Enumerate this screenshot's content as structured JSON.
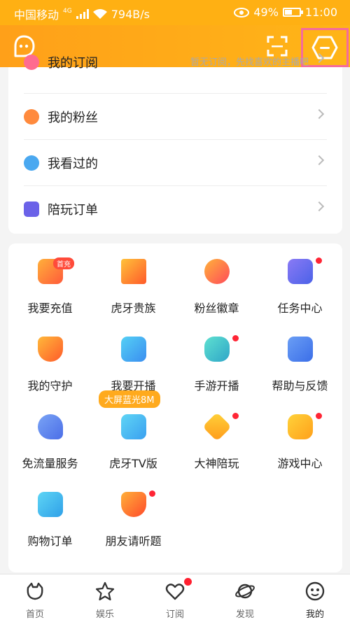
{
  "status_bar": {
    "carrier": "中国移动",
    "network": "4G",
    "speed": "794B/s",
    "battery": "49%",
    "time": "11:00"
  },
  "header": {
    "icons": [
      "message-icon",
      "scan-icon",
      "hexagon-icon"
    ]
  },
  "menu_list": [
    {
      "label": "我的订阅",
      "hint": "暂无订阅，先找喜欢的主播吧",
      "icon": "subscribe-icon",
      "color": "#ff6b8f"
    },
    {
      "label": "我的粉丝",
      "hint": "",
      "icon": "fans-icon",
      "color": "#ff8a3d"
    },
    {
      "label": "我看过的",
      "hint": "",
      "icon": "history-icon",
      "color": "#4aa8f0"
    },
    {
      "label": "陪玩订单",
      "hint": "",
      "icon": "order-icon",
      "color": "#6b62e8"
    }
  ],
  "grid": [
    {
      "label": "我要充值",
      "icon": "wallet-icon",
      "tag": "首充",
      "dot": false,
      "color": "#ff7a3a"
    },
    {
      "label": "虎牙贵族",
      "icon": "crown-icon",
      "tag": "",
      "dot": false,
      "color": "#ff8a2a"
    },
    {
      "label": "粉丝徽章",
      "icon": "heart-badge-icon",
      "tag": "",
      "dot": false,
      "color": "#ff6b4a"
    },
    {
      "label": "任务中心",
      "icon": "task-icon",
      "tag": "",
      "dot": true,
      "color": "#6a6ef0"
    },
    {
      "label": "我的守护",
      "icon": "shield-icon",
      "tag": "",
      "dot": false,
      "color": "#ff7b2f"
    },
    {
      "label": "我要开播",
      "icon": "video-icon",
      "tag": "",
      "dot": false,
      "color": "#3aa6f2"
    },
    {
      "label": "手游开播",
      "icon": "gamepad-icon",
      "tag": "",
      "dot": true,
      "color": "#35c6c0"
    },
    {
      "label": "帮助与反馈",
      "icon": "help-icon",
      "tag": "",
      "dot": false,
      "color": "#4b84f3"
    },
    {
      "label": "免流量服务",
      "icon": "satellite-icon",
      "tag": "",
      "dot": false,
      "color": "#5e7ef0"
    },
    {
      "label": "虎牙TV版",
      "icon": "tv-icon",
      "tag": "大屏蓝光8M",
      "dot": false,
      "color": "#3ab9f5"
    },
    {
      "label": "大神陪玩",
      "icon": "diamond-icon",
      "tag": "",
      "dot": true,
      "color": "#ffa11c"
    },
    {
      "label": "游戏中心",
      "icon": "game-controller-icon",
      "tag": "",
      "dot": true,
      "color": "#ffb21a"
    },
    {
      "label": "购物订单",
      "icon": "cart-icon",
      "tag": "",
      "dot": false,
      "color": "#38b9f0"
    },
    {
      "label": "朋友请听题",
      "icon": "trophy-icon",
      "tag": "",
      "dot": true,
      "color": "#ff6a2b"
    }
  ],
  "tabbar": [
    {
      "label": "首页",
      "icon": "home-icon",
      "badge": false
    },
    {
      "label": "娱乐",
      "icon": "star-icon",
      "badge": false
    },
    {
      "label": "订阅",
      "icon": "heart-icon",
      "badge": true
    },
    {
      "label": "发现",
      "icon": "planet-icon",
      "badge": false
    },
    {
      "label": "我的",
      "icon": "profile-icon",
      "badge": false
    }
  ]
}
